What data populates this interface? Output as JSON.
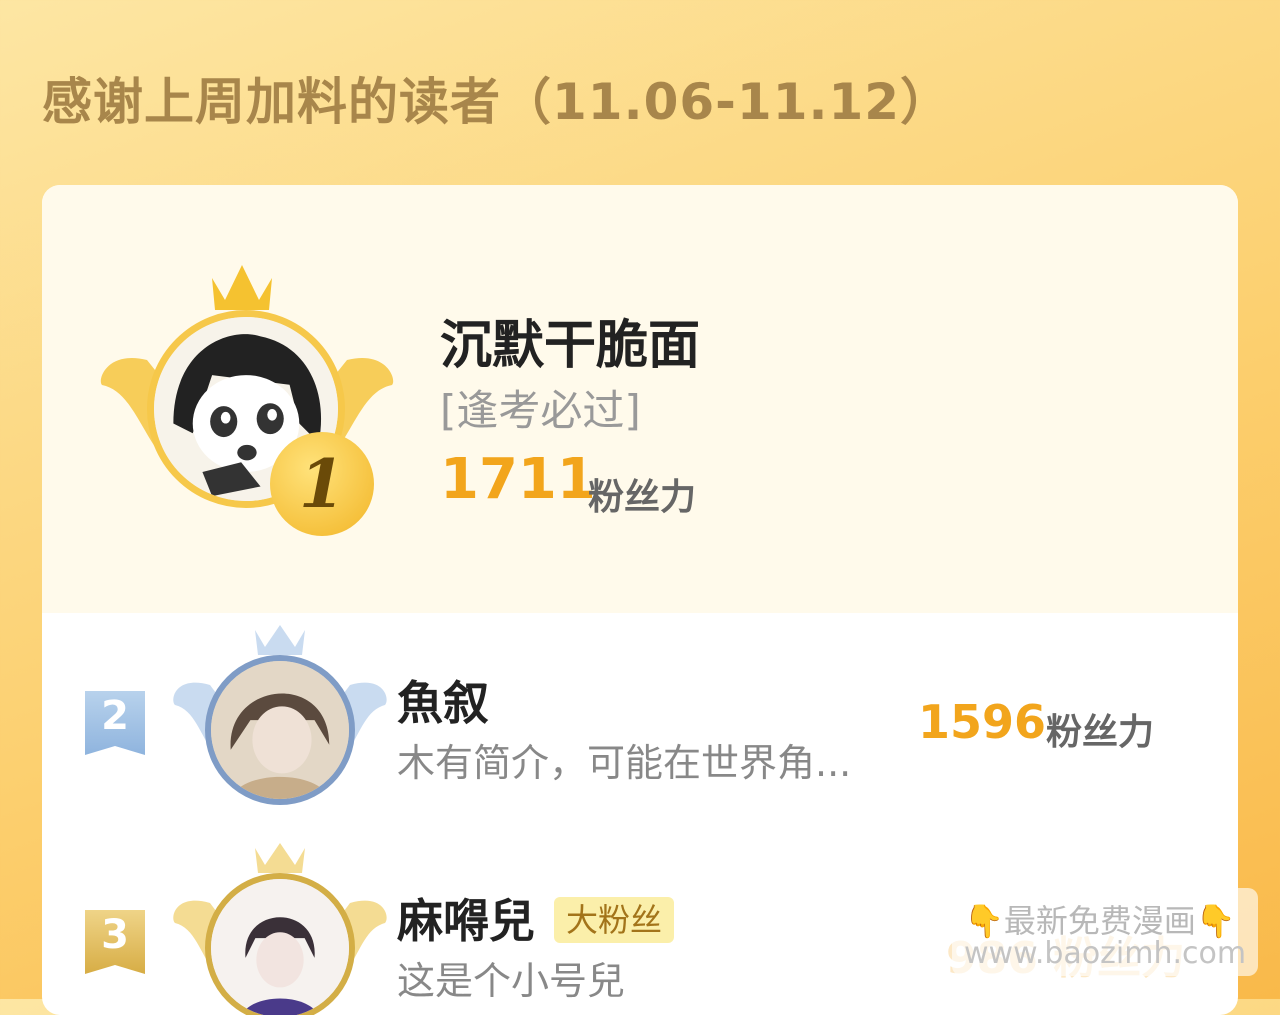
{
  "header": {
    "title": "感谢上周加料的读者（11.06-11.12）"
  },
  "top_reader": {
    "rank": "1",
    "name": "沉默干脆面",
    "signature": "[逢考必过]",
    "score": "1711",
    "unit": "粉丝力"
  },
  "readers": [
    {
      "rank": "2",
      "name": "魚叙",
      "description": "木有简介，可能在世界角...",
      "score": "1596",
      "unit": "粉丝力"
    },
    {
      "rank": "3",
      "name": "麻嘚兒",
      "badge": "大粉丝",
      "description": "这是个小号兒",
      "score": "986",
      "unit": "粉丝力"
    }
  ],
  "watermark": {
    "line1": "👇最新免费漫画👇",
    "line2": "www.baozimh.com"
  },
  "colors": {
    "accent": "#f2a51c",
    "title": "#a8864b",
    "rank2": "#8fb4de",
    "rank3": "#d7ad45"
  }
}
